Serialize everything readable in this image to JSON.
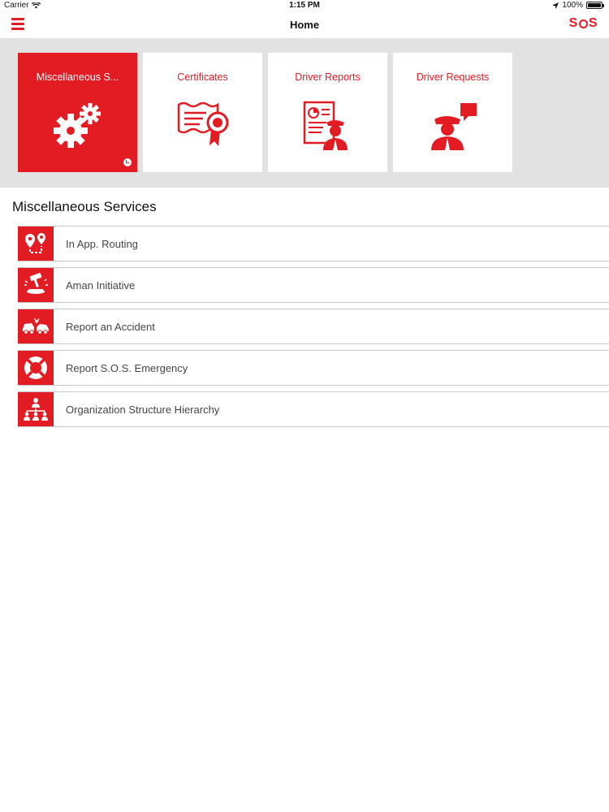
{
  "status_bar": {
    "carrier": "Carrier",
    "time": "1:15 PM",
    "battery": "100%",
    "battery_level": 1.0
  },
  "nav": {
    "title": "Home",
    "logo_left": "S",
    "logo_right": "S",
    "menu_icon": "hamburger-icon"
  },
  "colors": {
    "accent": "#e31b23",
    "panel_bg": "#e2e2e2",
    "text": "#444444"
  },
  "tiles": [
    {
      "label": "Miscellaneous S...",
      "icon": "gears-icon",
      "active": true
    },
    {
      "label": "Certificates",
      "icon": "certificate-icon",
      "active": false
    },
    {
      "label": "Driver Reports",
      "icon": "driver-report-icon",
      "active": false
    },
    {
      "label": "Driver Requests",
      "icon": "driver-request-icon",
      "active": false
    }
  ],
  "section": {
    "title": "Miscellaneous Services"
  },
  "services": [
    {
      "label": "In App. Routing",
      "icon": "route-pin-icon"
    },
    {
      "label": "Aman Initiative",
      "icon": "gavel-icon"
    },
    {
      "label": "Report an Accident",
      "icon": "car-accident-icon"
    },
    {
      "label": "Report S.O.S. Emergency",
      "icon": "lifebuoy-icon"
    },
    {
      "label": "Organization Structure Hierarchy",
      "icon": "org-chart-icon"
    }
  ]
}
